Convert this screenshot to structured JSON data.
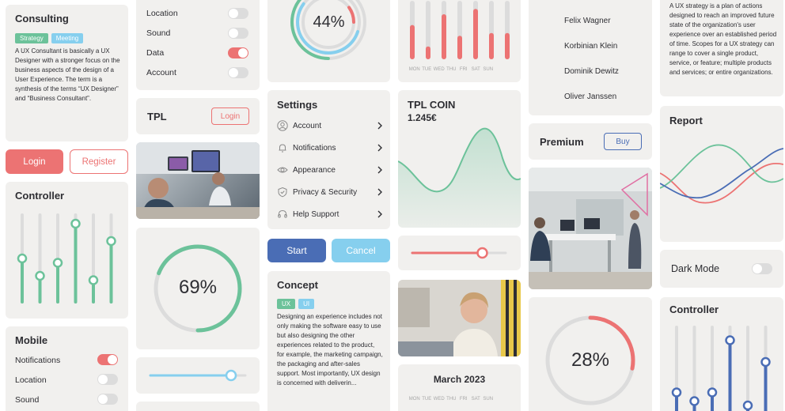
{
  "consulting": {
    "title": "Consulting",
    "tags": [
      "Strategy",
      "Meeting"
    ],
    "text": "A UX Consultant is basically a UX Designer with a stronger focus on the business aspects of the design of a User Experience. The term is a synthesis of the terms “UX Designer” and “Business Consultant”."
  },
  "auth": {
    "login_label": "Login",
    "register_label": "Register"
  },
  "controller_left": {
    "title": "Controller",
    "levels": [
      0.5,
      0.3,
      0.45,
      0.9,
      0.25,
      0.7
    ]
  },
  "mobile": {
    "title": "Mobile",
    "items": [
      {
        "label": "Notifications",
        "on": true
      },
      {
        "label": "Location",
        "on": false
      },
      {
        "label": "Sound",
        "on": false
      }
    ]
  },
  "toggles_top": {
    "items": [
      {
        "label": "Location",
        "on": false
      },
      {
        "label": "Sound",
        "on": false
      },
      {
        "label": "Data",
        "on": true
      },
      {
        "label": "Account",
        "on": false
      }
    ]
  },
  "tpl_card": {
    "title": "TPL",
    "login_label": "Login"
  },
  "progress_69": {
    "value": 69,
    "label": "69%"
  },
  "slider_blue": {
    "value": 0.85
  },
  "progress_44": {
    "value": 44,
    "label": "44%"
  },
  "settings": {
    "title": "Settings",
    "items": [
      {
        "label": "Account",
        "icon": "user-icon"
      },
      {
        "label": "Notifications",
        "icon": "bell-icon"
      },
      {
        "label": "Appearance",
        "icon": "eye-icon"
      },
      {
        "label": "Privacy & Security",
        "icon": "shield-icon"
      },
      {
        "label": "Help Support",
        "icon": "headset-icon"
      }
    ]
  },
  "actions": {
    "start_label": "Start",
    "cancel_label": "Cancel"
  },
  "concept": {
    "title": "Concept",
    "tags": [
      "UX",
      "UI"
    ],
    "text": "Designing an experience includes not only making the software easy to use but also designing the other experiences related to the product, for example, the marketing campaign, the packaging and after-sales support. Most importantly, UX design is concerned with deliverin..."
  },
  "weekly_bars": {
    "days": [
      "MON",
      "TUE",
      "WED",
      "THU",
      "FRI",
      "SAT",
      "SUN"
    ],
    "levels": [
      0.55,
      0.15,
      0.75,
      0.35,
      0.85,
      0.4,
      0.4
    ]
  },
  "coin": {
    "title": "TPL COIN",
    "value": "1.245€"
  },
  "slider_red": {
    "value": 0.75
  },
  "calendar": {
    "title": "March 2023",
    "days": [
      "MON",
      "TUE",
      "WED",
      "THU",
      "FRI",
      "SAT",
      "SUN"
    ]
  },
  "names": {
    "items": [
      "Felix Wagner",
      "Korbinian Klein",
      "Dominik Dewitz",
      "Oliver Janssen"
    ]
  },
  "premium": {
    "title": "Premium",
    "buy_label": "Buy"
  },
  "progress_28": {
    "value": 28,
    "label": "28%"
  },
  "strategy": {
    "text": "A UX strategy is a plan of actions designed to reach an improved future state of the organization's user experience over an established period of time. Scopes for a UX strategy can range to cover a single product, service, or feature; multiple products and services; or entire organizations."
  },
  "report": {
    "title": "Report"
  },
  "dark_mode": {
    "label": "Dark Mode",
    "on": false
  },
  "controller_right": {
    "title": "Controller",
    "levels": [
      0.25,
      0.15,
      0.25,
      0.85,
      0.1,
      0.6
    ]
  },
  "colors": {
    "green": "#6cc29a",
    "red": "#ec7373",
    "blue": "#4a6db5",
    "light_blue": "#86cfee",
    "bg": "#f1f0ee"
  }
}
